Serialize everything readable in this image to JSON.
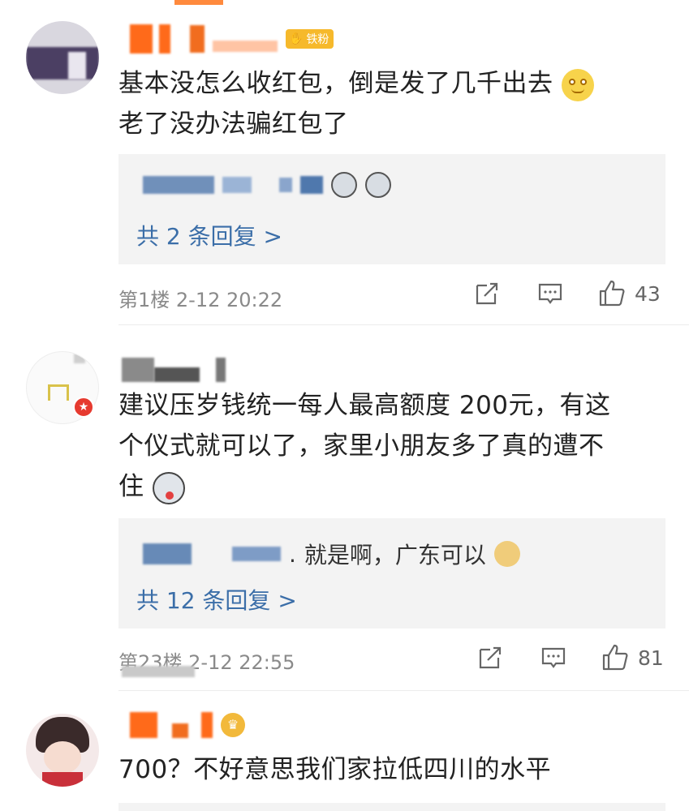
{
  "comments": [
    {
      "badge_label": "铁粉",
      "text_line1": "基本没怎么收红包，倒是发了几千出去",
      "text_line2": "老了没办法骗红包了",
      "reply_more": "共 2 条回复 >",
      "floor_time": "第1楼  2-12 20:22",
      "like_count": "43",
      "emoji_icon": "smile-emoji-icon"
    },
    {
      "text_line1": "建议压岁钱统一每人最高额度 200元，有这",
      "text_line2": "个仪式就可以了，家里小朋友多了真的遭不",
      "text_line3": "住",
      "reply_preview": "就是啊，广东可以",
      "reply_more": "共 12 条回复 >",
      "floor_time": "第23楼  2-12 22:55",
      "like_count": "81"
    },
    {
      "text_line1": "700？不好意思我们家拉低四川的水平"
    }
  ],
  "colors": {
    "badge": "#f6b92b",
    "link": "#3b6ea8",
    "meta": "#8a8a8a",
    "reply_bg": "#f3f3f3"
  }
}
